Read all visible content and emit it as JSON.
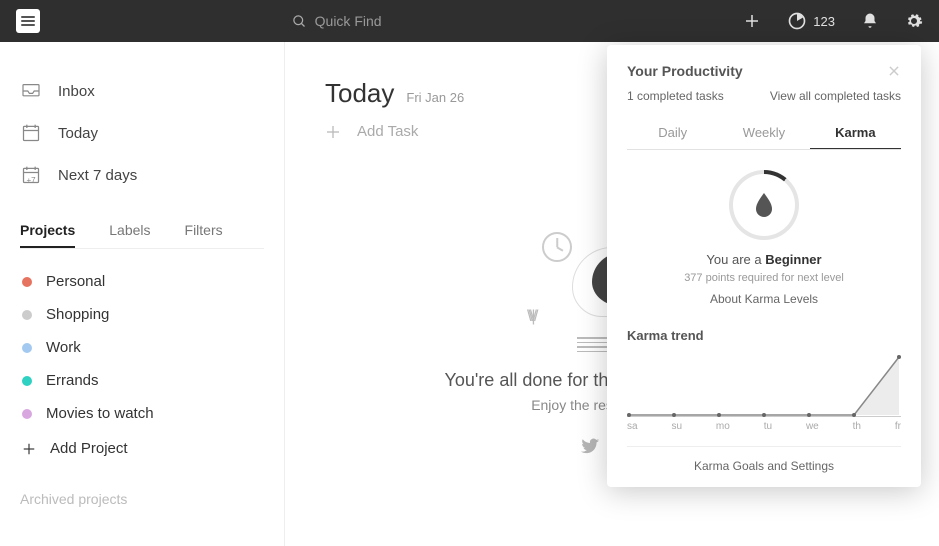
{
  "topbar": {
    "search_placeholder": "Quick Find",
    "karma_count": "123"
  },
  "sidebar": {
    "nav": {
      "inbox": "Inbox",
      "today": "Today",
      "next7": "Next 7 days",
      "next7_badge": "+7"
    },
    "tabs": {
      "projects": "Projects",
      "labels": "Labels",
      "filters": "Filters"
    },
    "projects": [
      {
        "name": "Personal",
        "color": "#e6735f"
      },
      {
        "name": "Shopping",
        "color": "#cccccc"
      },
      {
        "name": "Work",
        "color": "#a3c9f0"
      },
      {
        "name": "Errands",
        "color": "#2fd1c2"
      },
      {
        "name": "Movies to watch",
        "color": "#d9a7e0"
      }
    ],
    "add_project": "Add Project",
    "archived": "Archived projects"
  },
  "main": {
    "title": "Today",
    "date": "Fri Jan 26",
    "add_task": "Add Task",
    "done_headline": "You're all done for the week! #TodoistZero",
    "done_sub": "Enjoy the rest of your day."
  },
  "panel": {
    "title": "Your Productivity",
    "completed_tasks": "1 completed tasks",
    "view_all": "View all completed tasks",
    "tabs": {
      "daily": "Daily",
      "weekly": "Weekly",
      "karma": "Karma"
    },
    "karma_you_are": "You are a ",
    "karma_level": "Beginner",
    "karma_points": "377 points required for next level",
    "about_karma": "About Karma Levels",
    "trend_title": "Karma trend",
    "footer": "Karma Goals and Settings"
  },
  "chart_data": {
    "type": "line",
    "categories": [
      "sa",
      "su",
      "mo",
      "tu",
      "we",
      "th",
      "fr"
    ],
    "values": [
      0,
      0,
      0,
      0,
      0,
      0,
      1
    ],
    "title": "Karma trend",
    "ylim": [
      0,
      1
    ]
  }
}
